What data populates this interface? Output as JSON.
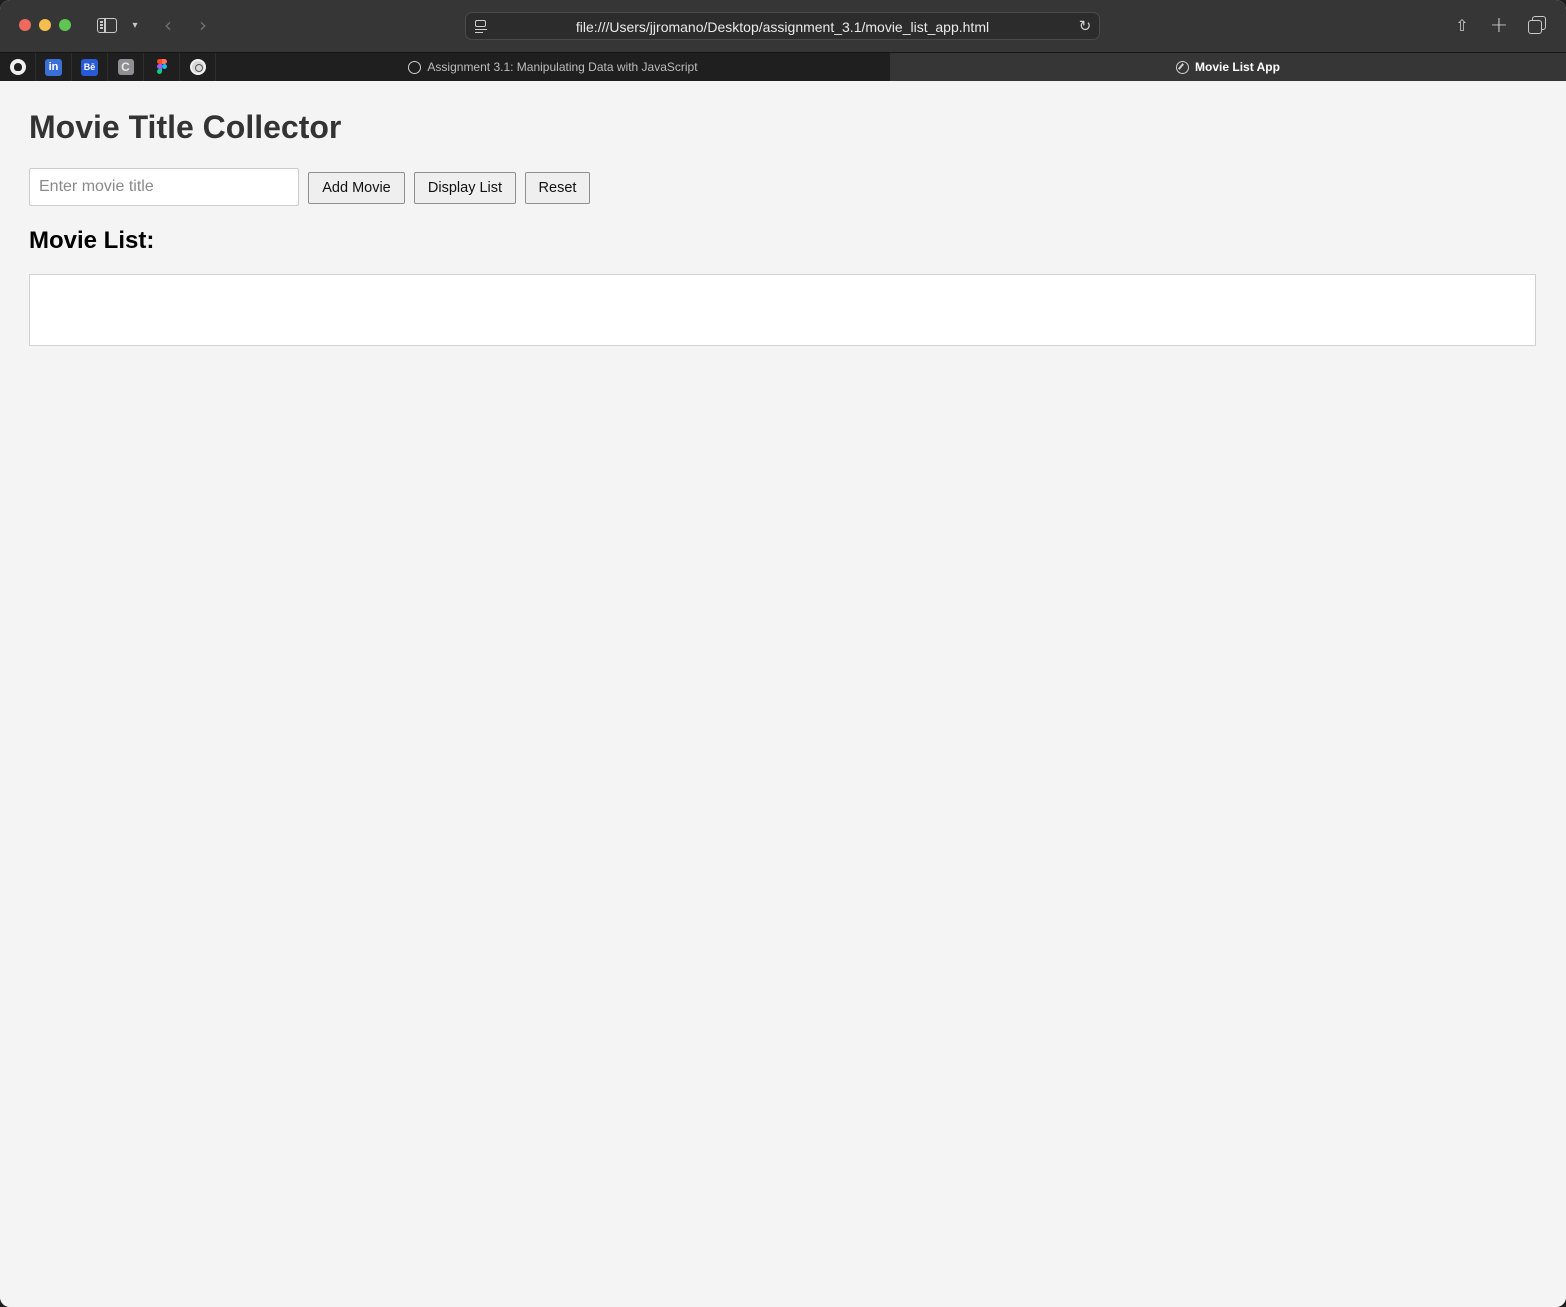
{
  "browser": {
    "address": "file:///Users/jjromano/Desktop/assignment_3.1/movie_list_app.html",
    "icons": {
      "sidebar": "sidebar-icon",
      "back": "chevron-left-icon",
      "forward": "chevron-right-icon",
      "reload": "reload-icon",
      "share": "share-icon",
      "new_tab": "plus-icon",
      "tab_overview": "tab-overview-icon"
    },
    "pinned_tabs": {
      "linkedin": "in",
      "behance": "Bē",
      "c": "C"
    },
    "tabs": [
      {
        "label": "Assignment 3.1: Manipulating Data with JavaScript",
        "active": false
      },
      {
        "label": "Movie List App",
        "active": true
      }
    ]
  },
  "page": {
    "title": "Movie Title Collector",
    "input": {
      "placeholder": "Enter movie title",
      "value": ""
    },
    "buttons": {
      "add": "Add Movie",
      "display": "Display List",
      "reset": "Reset"
    },
    "list_heading": "Movie List:",
    "movies": []
  },
  "colors": {
    "page_background": "#f4f4f4",
    "title_text": "#333333",
    "toolbar": "#363636"
  }
}
